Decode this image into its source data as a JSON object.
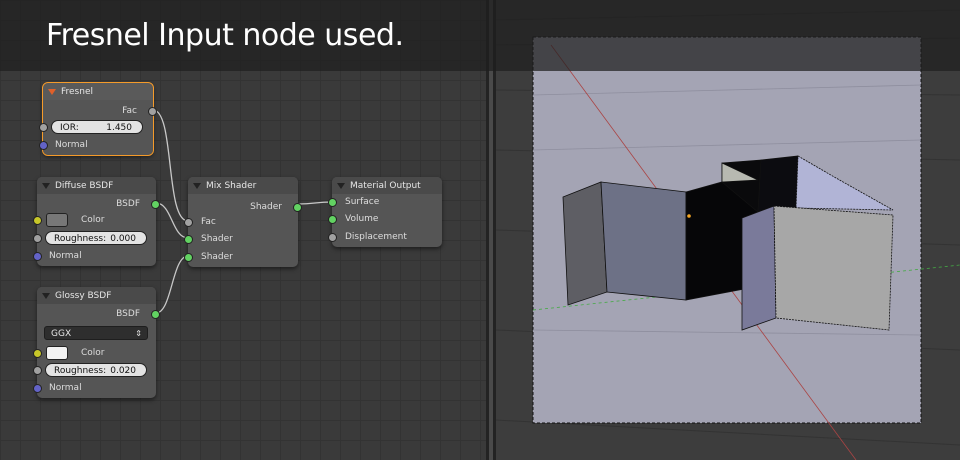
{
  "banner": {
    "title": "Fresnel Input node used."
  },
  "nodes": {
    "fresnel": {
      "title": "Fresnel",
      "out_fac": "Fac",
      "ior_label": "IOR:",
      "ior_value": "1.450",
      "normal": "Normal"
    },
    "diffuse": {
      "title": "Diffuse BSDF",
      "out": "BSDF",
      "color": "Color",
      "roughness_label": "Roughness:",
      "roughness_value": "0.000",
      "normal": "Normal"
    },
    "glossy": {
      "title": "Glossy BSDF",
      "out": "BSDF",
      "distribution": "GGX",
      "color": "Color",
      "roughness_label": "Roughness:",
      "roughness_value": "0.020",
      "normal": "Normal"
    },
    "mix": {
      "title": "Mix Shader",
      "out": "Shader",
      "fac": "Fac",
      "shader1": "Shader",
      "shader2": "Shader"
    },
    "output": {
      "title": "Material Output",
      "surface": "Surface",
      "volume": "Volume",
      "displacement": "Displacement"
    }
  },
  "colors": {
    "active_outline": "#f59b2a",
    "socket_shader": "#62d262",
    "socket_float": "#a1a1a1",
    "socket_color": "#c7c729",
    "socket_vector": "#6363c7",
    "viewport_bg": "#a4a4b4"
  }
}
